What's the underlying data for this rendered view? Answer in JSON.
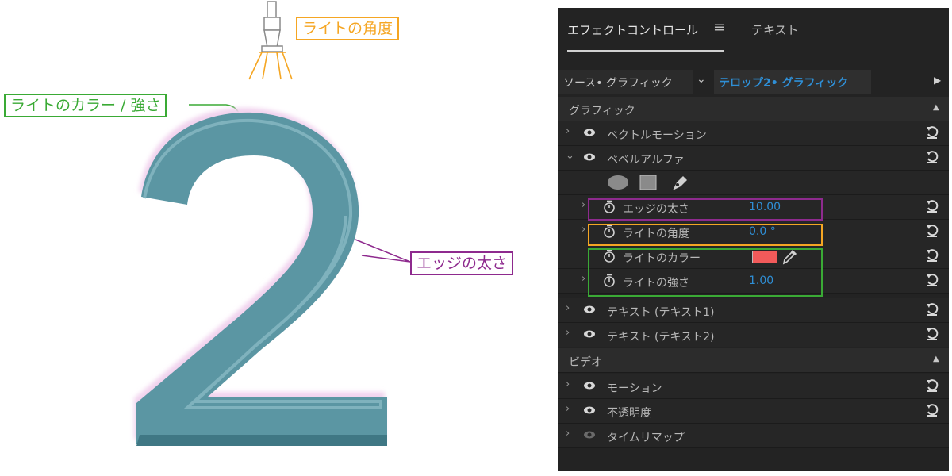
{
  "callouts": {
    "light_angle": "ライトの角度",
    "light_color_intensity": "ライトのカラー / 強さ",
    "edge_thickness": "エッジの太さ"
  },
  "canvas_glyph": "2",
  "panel": {
    "tab_effect_controls": "エフェクトコントロール",
    "tab_menu_icon": "≡",
    "tab_text": "テキスト",
    "source_label": "ソース• グラフィック",
    "source_target": "テロップ2• グラフィック",
    "sections": {
      "graphic": "グラフィック",
      "video": "ビデオ"
    },
    "vector_motion": "ベクトルモーション",
    "bevel_alpha": "ベベルアルファ",
    "params": {
      "edge_thickness": {
        "label": "エッジの太さ",
        "value": "10.00"
      },
      "light_angle": {
        "label": "ライトの角度",
        "value": "0.0 °"
      },
      "light_color": {
        "label": "ライトのカラー",
        "color": "#f25a5a"
      },
      "light_intensity": {
        "label": "ライトの強さ",
        "value": "1.00"
      }
    },
    "text_layers": [
      "テキスト (テキスト1)",
      "テキスト (テキスト2)"
    ],
    "video_items": [
      "モーション",
      "不透明度",
      "タイムリマップ"
    ]
  },
  "colors": {
    "accent_blue": "#2f8fd6",
    "angle_orange": "#f5a623",
    "light_green": "#3aaa35",
    "edge_purple": "#8e2a8e",
    "glyph_teal": "#5a97a3",
    "glyph_highlight": "#f3d4ef"
  }
}
